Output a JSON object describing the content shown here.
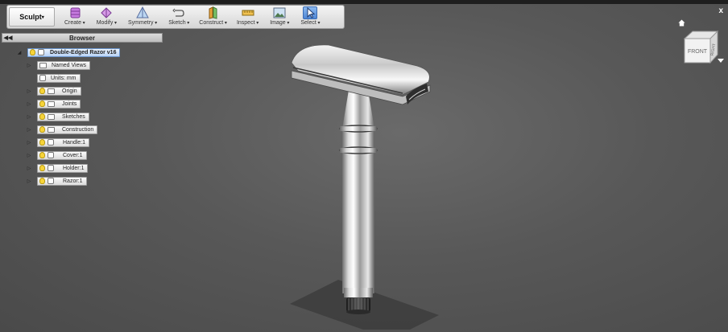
{
  "window": {
    "close_label": "x"
  },
  "toolbar": {
    "workspace": "Sculpt",
    "tools": [
      {
        "label": "Create"
      },
      {
        "label": "Modify"
      },
      {
        "label": "Symmetry"
      },
      {
        "label": "Sketch"
      },
      {
        "label": "Construct"
      },
      {
        "label": "Inspect"
      },
      {
        "label": "Image"
      },
      {
        "label": "Select"
      }
    ]
  },
  "browser": {
    "title": "Browser",
    "root": "Double-Edged Razor v16",
    "items": [
      {
        "label": "Named Views"
      },
      {
        "label": "Units: mm"
      },
      {
        "label": "Origin"
      },
      {
        "label": "Joints"
      },
      {
        "label": "Sketches"
      },
      {
        "label": "Construction"
      },
      {
        "label": "Handle:1"
      },
      {
        "label": "Cover:1"
      },
      {
        "label": "Holder:1"
      },
      {
        "label": "Razor:1"
      }
    ]
  },
  "viewcube": {
    "front": "FRONT",
    "right": "RIGHT"
  },
  "colors": {
    "selection": "#4f86d4",
    "bulb": "#f7d43a",
    "background": "#585858"
  }
}
